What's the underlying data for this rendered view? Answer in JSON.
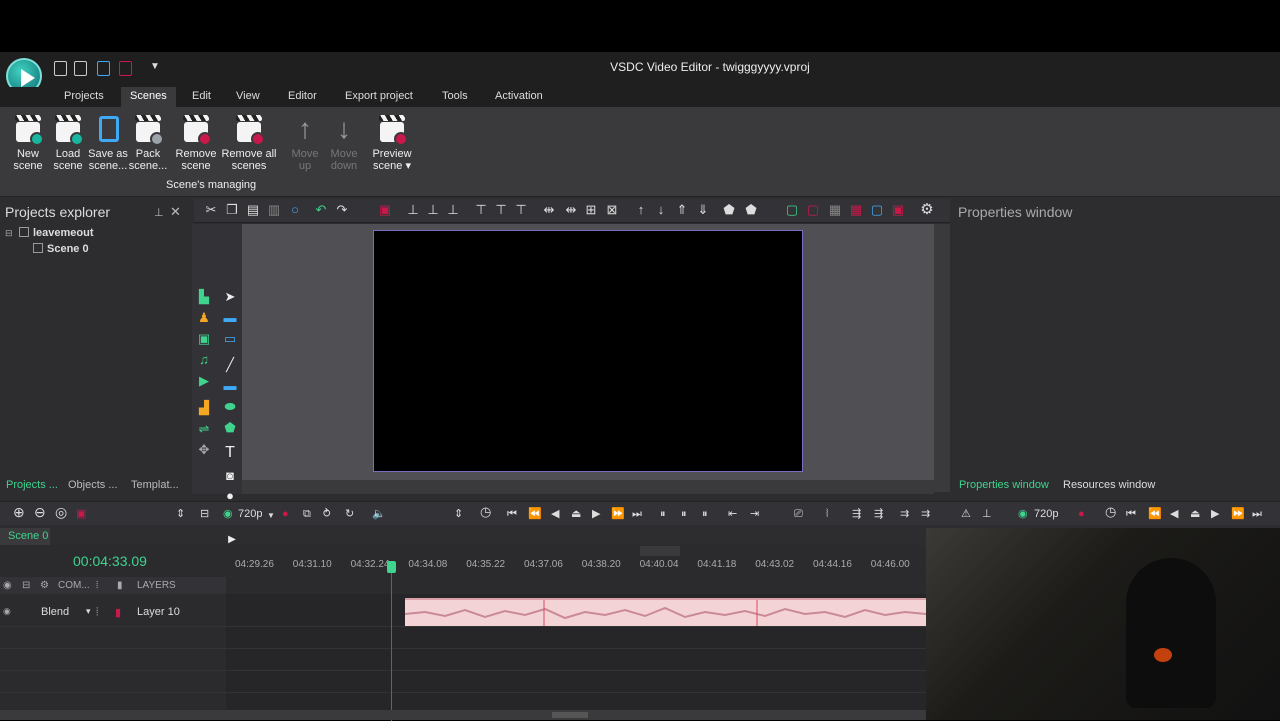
{
  "window": {
    "title": "VSDC Video Editor - twigggyyyy.vproj"
  },
  "menu": {
    "items": [
      "Projects",
      "Scenes",
      "Edit",
      "View",
      "Editor",
      "Export project",
      "Tools",
      "Activation"
    ],
    "active": "Scenes"
  },
  "ribbon": {
    "buttons": [
      {
        "l1": "New",
        "l2": "scene"
      },
      {
        "l1": "Load",
        "l2": "scene"
      },
      {
        "l1": "Save as",
        "l2": "scene..."
      },
      {
        "l1": "Pack",
        "l2": "scene..."
      },
      {
        "l1": "Remove",
        "l2": "scene"
      },
      {
        "l1": "Remove all",
        "l2": "scenes"
      },
      {
        "l1": "Move",
        "l2": "up"
      },
      {
        "l1": "Move",
        "l2": "down"
      },
      {
        "l1": "Preview",
        "l2": "scene ▾"
      }
    ],
    "group_label": "Scene's managing"
  },
  "projects_explorer": {
    "title": "Projects explorer",
    "tree": [
      "leavemeout",
      "Scene 0"
    ],
    "tabs": [
      "Projects ...",
      "Objects ...",
      "Templat..."
    ]
  },
  "properties": {
    "title": "Properties window",
    "tabs": [
      "Properties window",
      "Resources window"
    ]
  },
  "transport": {
    "resolution": "720p",
    "resolution_right": "720p"
  },
  "timeline": {
    "scene_tab": "Scene 0",
    "timecode": "00:04:33.09",
    "ticks": [
      "04:29.26",
      "04:31.10",
      "04:32.24",
      "04:34.08",
      "04:35.22",
      "04:37.06",
      "04:38.20",
      "04:40.04",
      "04:41.18",
      "04:43.02",
      "04:44.16",
      "04:46.00"
    ],
    "header": {
      "com": "COM...",
      "layers": "LAYERS"
    },
    "layer": {
      "blend": "Blend",
      "name": "Layer 10"
    }
  },
  "colors": {
    "accent": "#3fd38e",
    "playhead": "#c0394b",
    "clip": "#f4d3d7"
  }
}
